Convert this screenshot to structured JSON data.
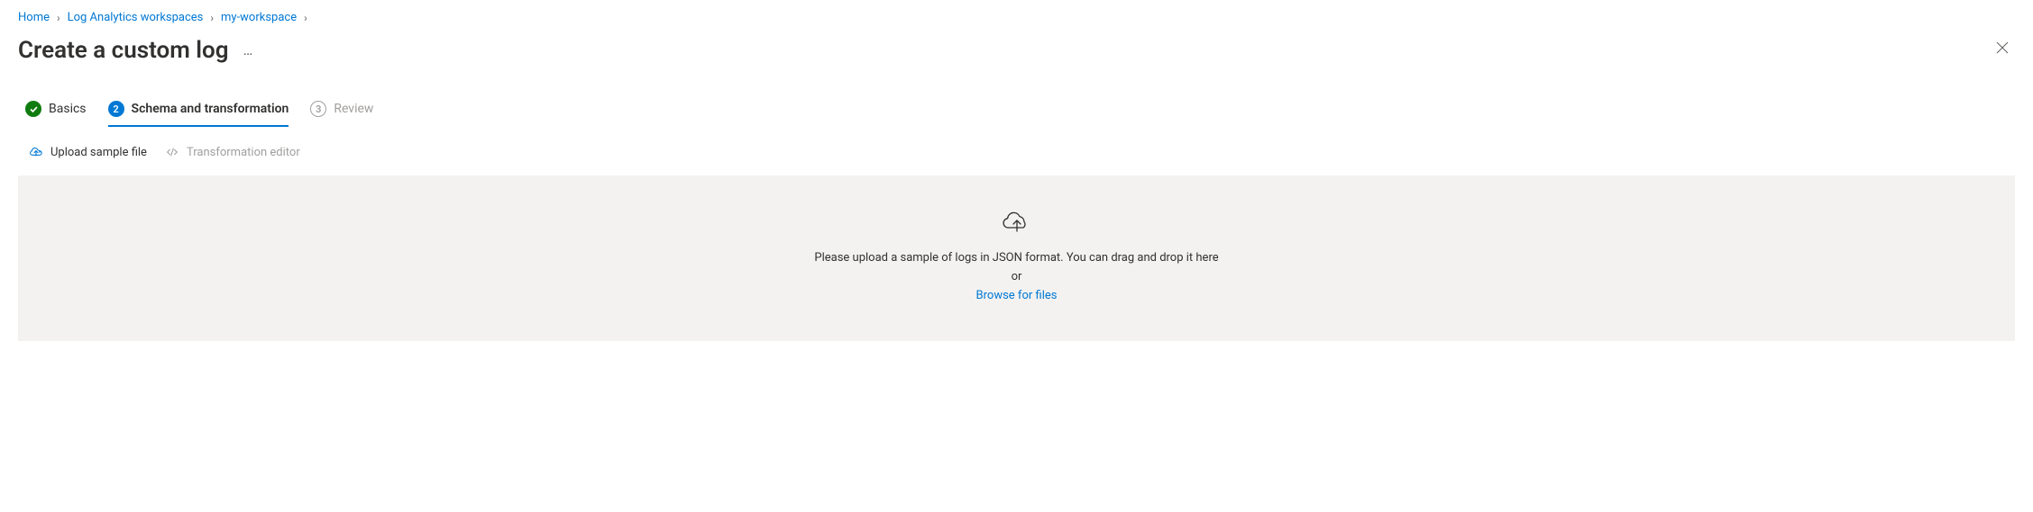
{
  "breadcrumb": {
    "items": [
      {
        "label": "Home"
      },
      {
        "label": "Log Analytics workspaces"
      },
      {
        "label": "my-workspace"
      }
    ]
  },
  "header": {
    "title": "Create a custom log"
  },
  "wizard": {
    "steps": [
      {
        "label": "Basics",
        "state": "completed"
      },
      {
        "label": "Schema and transformation",
        "number": "2",
        "state": "current"
      },
      {
        "label": "Review",
        "number": "3",
        "state": "pending"
      }
    ]
  },
  "subtabs": {
    "items": [
      {
        "label": "Upload sample file",
        "state": "active"
      },
      {
        "label": "Transformation editor",
        "state": "disabled"
      }
    ]
  },
  "dropzone": {
    "line1": "Please upload a sample of logs in JSON format. You can drag and drop it here",
    "line2": "or",
    "browse": "Browse for files"
  }
}
